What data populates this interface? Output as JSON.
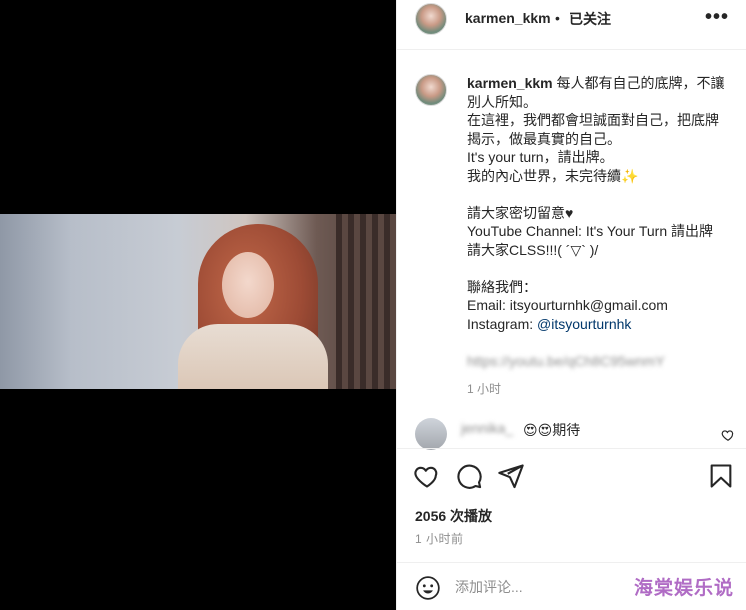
{
  "header": {
    "username": "karmen_kkm",
    "separator": "•",
    "follow_status": "已关注",
    "more_label": "•••"
  },
  "caption": {
    "username": "karmen_kkm",
    "lines": [
      "每人都有自己的底牌，不讓",
      "別人所知。",
      "在這裡，我們都會坦誠面對自己，把底牌",
      "揭示，做最真實的自己。",
      "It's your turn，請出牌。",
      "我的內心世界，未完待續✨",
      "",
      "請大家密切留意♥",
      "YouTube Channel: It's Your Turn 請出牌",
      "請大家CLSS!!!( ´▽` )/",
      "",
      "聯絡我們：",
      "Email: itsyourturnhk@gmail.com"
    ],
    "instagram_label": "Instagram: ",
    "instagram_handle": "@itsyourturnhk",
    "blurred_link": "https://youtu.be/qCh8C95wnmY",
    "time": "1 小时"
  },
  "comment": {
    "username": "jennika_",
    "text": "😍😍期待"
  },
  "stats": {
    "views": "2056 次播放",
    "posted": "1 小时前"
  },
  "add_comment": {
    "placeholder": "添加评论..."
  },
  "watermark": "海棠娱乐说",
  "icons": {
    "like": "heart-icon",
    "comment": "comment-icon",
    "share": "share-icon",
    "save": "bookmark-icon",
    "emoji": "emoji-icon"
  }
}
